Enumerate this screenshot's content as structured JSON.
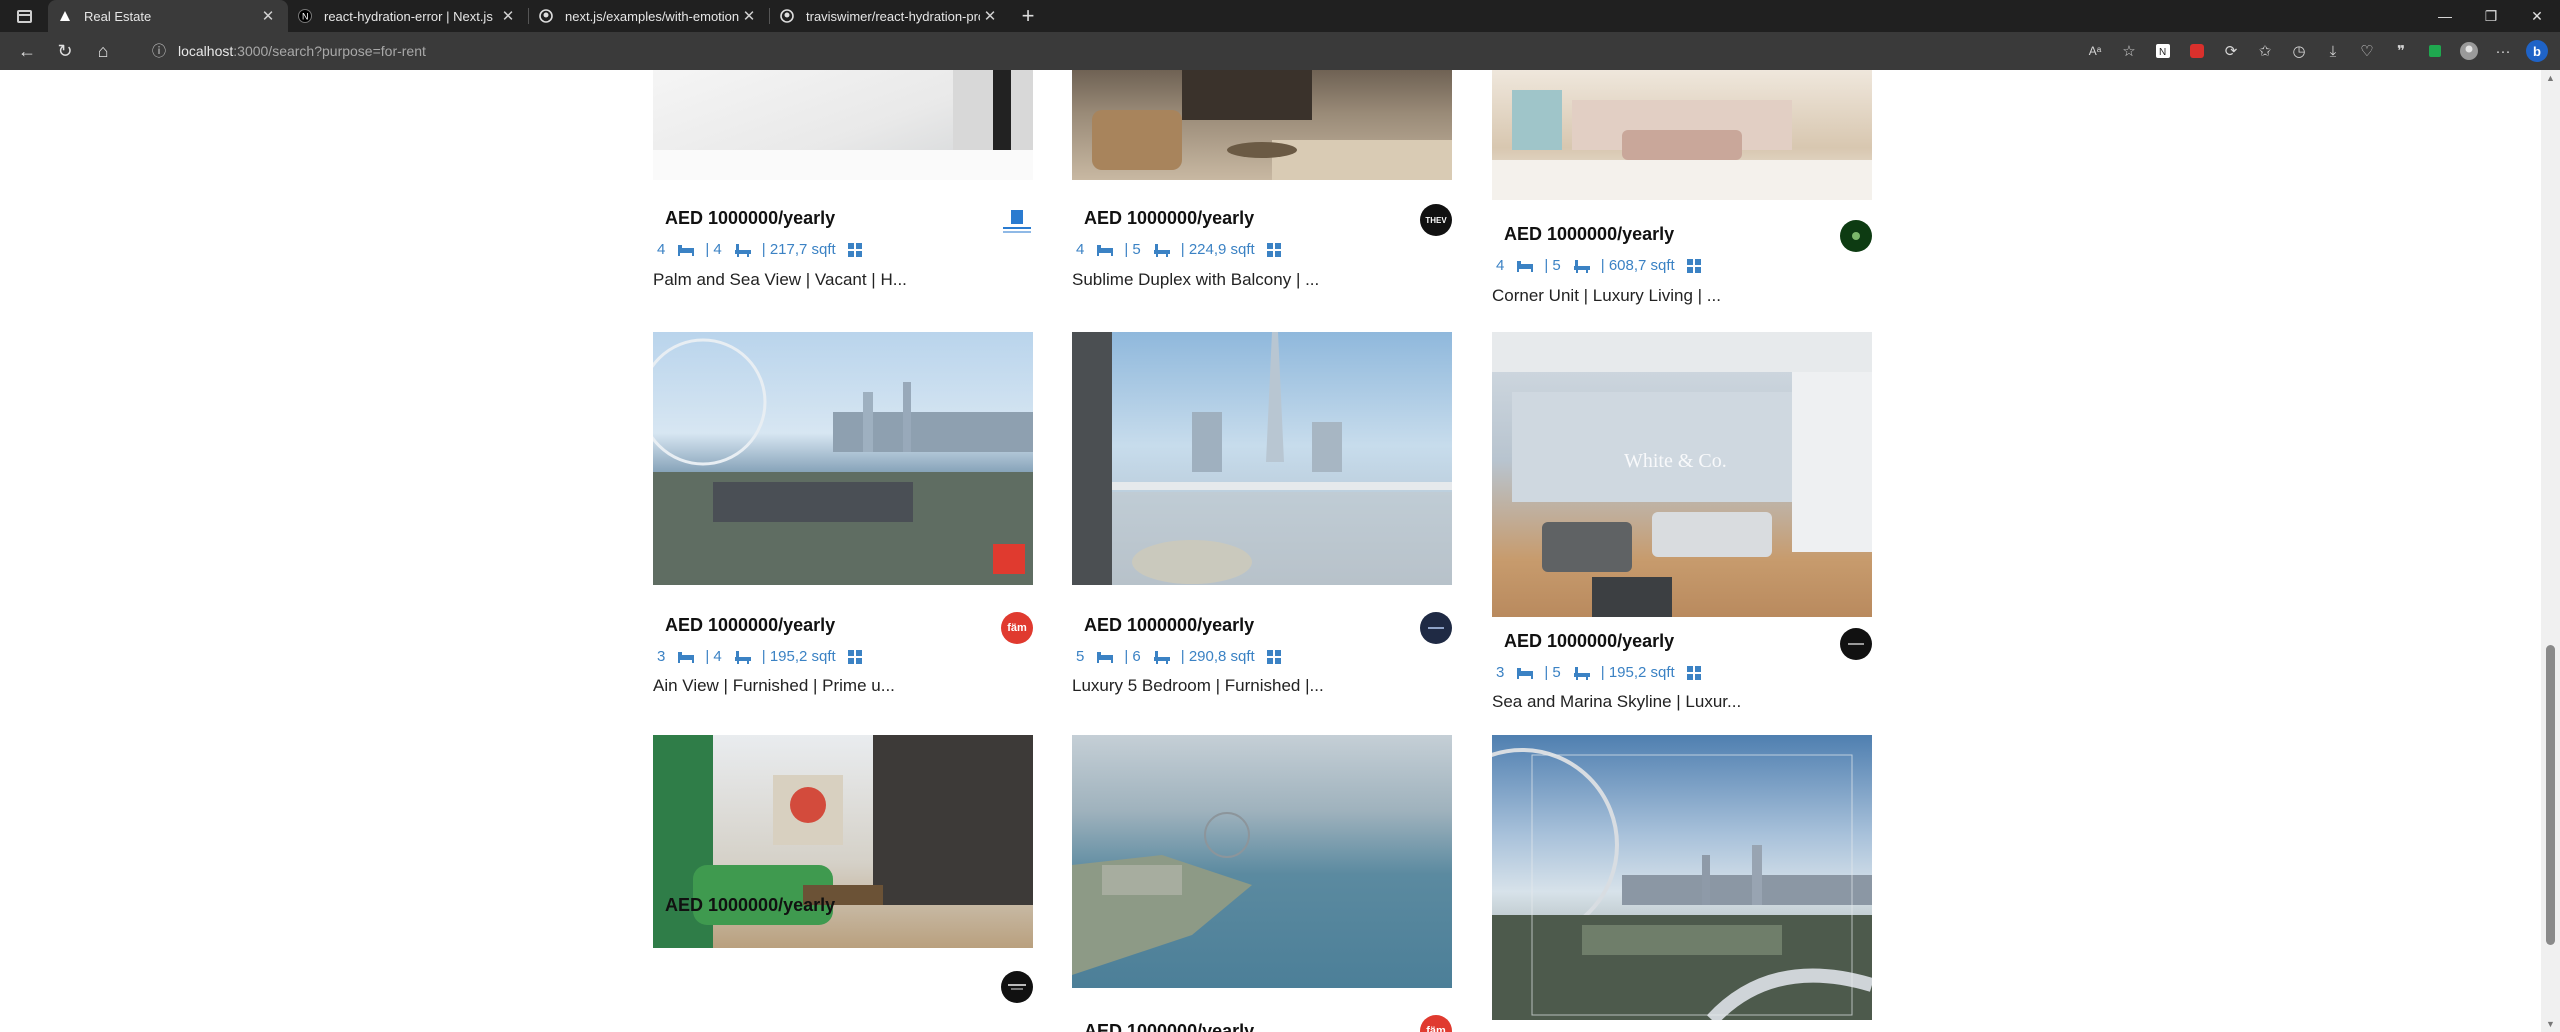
{
  "tabs": [
    {
      "title": "Real Estate",
      "active": true
    },
    {
      "title": "react-hydration-error | Next.js",
      "active": false
    },
    {
      "title": "next.js/examples/with-emotion a",
      "active": false
    },
    {
      "title": "traviswimer/react-hydration-pro",
      "active": false
    }
  ],
  "address": {
    "host": "localhost",
    "path": ":3000/search?purpose=for-rent"
  },
  "colors": {
    "meta": "#3b82c4",
    "chrome_dark": "#202020",
    "chrome_toolbar": "#3a3a3a"
  },
  "listings": [
    {
      "price": "AED 1000000/yearly",
      "rooms": "4",
      "baths": "| 4",
      "area": "| 217,7 sqft",
      "name": "Palm and Sea View | Vacant | H...",
      "agency_icon": "agency-logo-blue"
    },
    {
      "price": "AED 1000000/yearly",
      "rooms": "4",
      "baths": "| 5",
      "area": "| 224,9 sqft",
      "name": "Sublime Duplex with Balcony | ...",
      "agency_icon": "agency-logo-thev"
    },
    {
      "price": "AED 1000000/yearly",
      "rooms": "4",
      "baths": "| 5",
      "area": "| 608,7 sqft",
      "name": "Corner Unit | Luxury Living | ...",
      "agency_icon": "agency-logo-green"
    },
    {
      "price": "AED 1000000/yearly",
      "rooms": "3",
      "baths": "| 4",
      "area": "| 195,2 sqft",
      "name": "Ain View | Furnished | Prime u...",
      "agency_icon": "agency-logo-fam"
    },
    {
      "price": "AED 1000000/yearly",
      "rooms": "5",
      "baths": "| 6",
      "area": "| 290,8 sqft",
      "name": "Luxury 5 Bedroom | Furnished |...",
      "agency_icon": "agency-logo-navy"
    },
    {
      "price": "AED 1000000/yearly",
      "rooms": "3",
      "baths": "| 5",
      "area": "| 195,2 sqft",
      "name": "Sea and Marina Skyline | Luxur...",
      "agency_icon": "agency-logo-black"
    },
    {
      "price": "AED 1000000/yearly",
      "agency_icon": "agency-logo-luxury"
    },
    {
      "price": "AED 1000000/yearly",
      "agency_icon": "agency-logo-fam"
    }
  ],
  "agency_labels": {
    "fam": "fäm",
    "thev": "THEV",
    "white_co": "White & Co."
  }
}
